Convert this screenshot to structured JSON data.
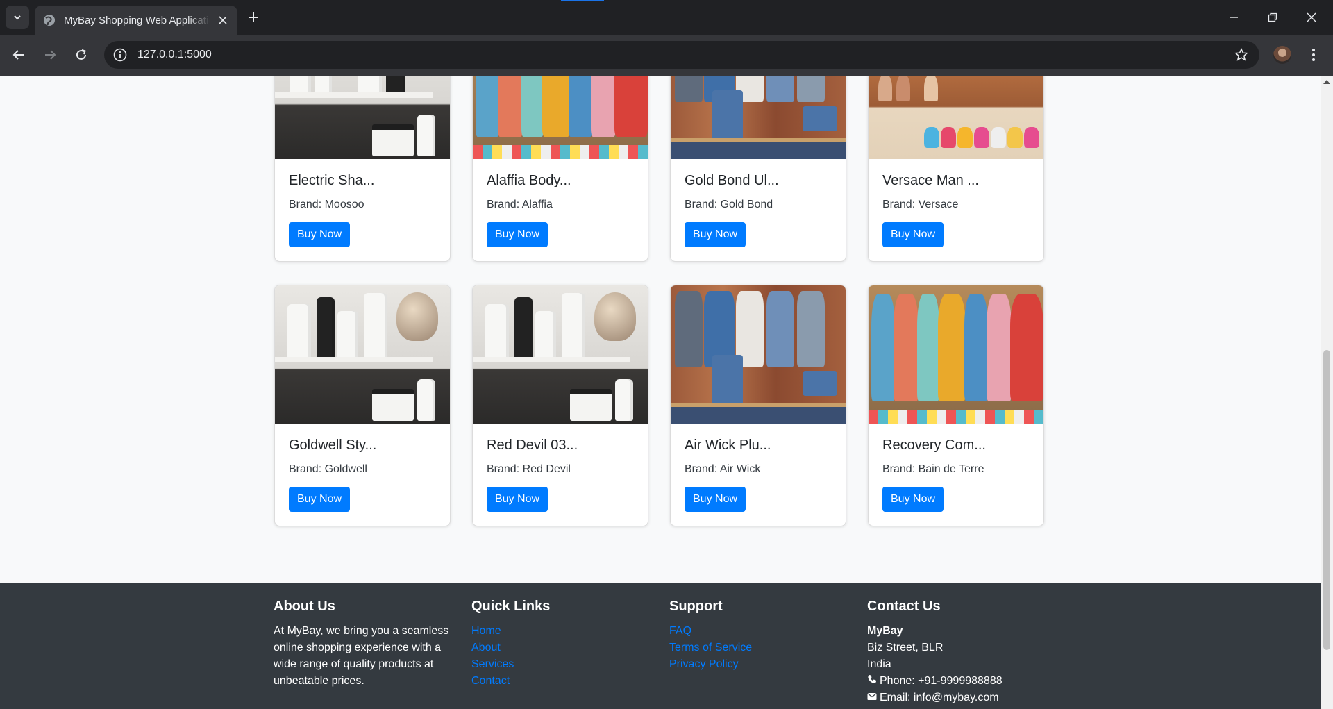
{
  "browser": {
    "tab_title": "MyBay Shopping Web Application",
    "url": "127.0.0.1:5000"
  },
  "buy_label": "Buy Now",
  "products_row1": [
    {
      "name": "Electric Sha...",
      "brand": "Brand: Moosoo",
      "image": "grooming"
    },
    {
      "name": "Alaffia Body...",
      "brand": "Brand: Alaffia",
      "image": "dresses"
    },
    {
      "name": "Gold Bond Ul...",
      "brand": "Brand: Gold Bond",
      "image": "mens"
    },
    {
      "name": "Versace Man ...",
      "brand": "Brand: Versace",
      "image": "shoes"
    }
  ],
  "products_row2": [
    {
      "name": "Goldwell Sty...",
      "brand": "Brand: Goldwell",
      "image": "grooming"
    },
    {
      "name": "Red Devil 03...",
      "brand": "Brand: Red Devil",
      "image": "grooming"
    },
    {
      "name": "Air Wick Plu...",
      "brand": "Brand: Air Wick",
      "image": "mens"
    },
    {
      "name": "Recovery Com...",
      "brand": "Brand: Bain de Terre",
      "image": "dresses"
    }
  ],
  "footer": {
    "about": {
      "title": "About Us",
      "text": "At MyBay, we bring you a seamless online shopping experience with a wide range of quality products at unbeatable prices."
    },
    "quick_links": {
      "title": "Quick Links",
      "links": [
        "Home",
        "About",
        "Services",
        "Contact"
      ]
    },
    "support": {
      "title": "Support",
      "links": [
        "FAQ",
        "Terms of Service",
        "Privacy Policy"
      ]
    },
    "contact": {
      "title": "Contact Us",
      "company": "MyBay",
      "street": "Biz Street, BLR",
      "country": "India",
      "phone": "Phone: +91-9999988888",
      "email": "Email: info@mybay.com"
    }
  },
  "colors": {
    "primary": "#007bff",
    "footer_bg": "#343a40",
    "page_bg": "#f8f9fa"
  }
}
